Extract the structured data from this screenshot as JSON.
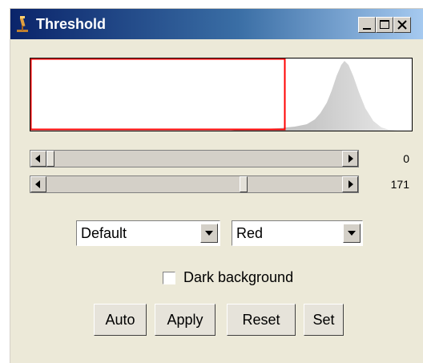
{
  "window": {
    "title": "Threshold",
    "controls": [
      "minimize-icon",
      "maximize-icon",
      "close-icon"
    ]
  },
  "histogram": {
    "selection_color": "#ff0000"
  },
  "sliders": {
    "lower": {
      "value": "0",
      "fraction": 0.0
    },
    "upper": {
      "value": "171",
      "fraction": 0.67
    }
  },
  "method_select": {
    "selected": "Default"
  },
  "display_select": {
    "selected": "Red"
  },
  "dark_background": {
    "label": "Dark background",
    "checked": false
  },
  "buttons": {
    "auto": "Auto",
    "apply": "Apply",
    "reset": "Reset",
    "set": "Set"
  },
  "colors": {
    "title_bar_start": "#0a246a",
    "title_bar_end": "#a6caf0",
    "face": "#ece9d8"
  }
}
